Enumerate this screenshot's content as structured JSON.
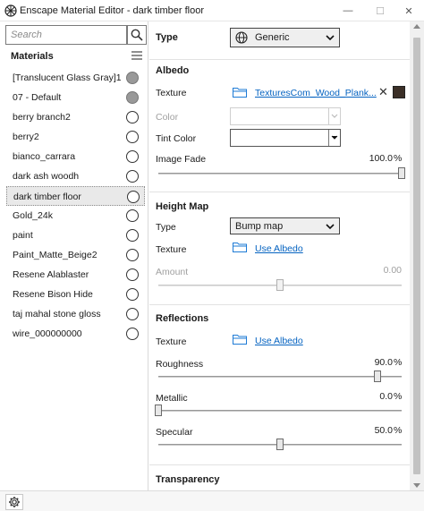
{
  "window": {
    "title": "Enscape Material Editor - dark timber floor",
    "minimize_glyph": "—",
    "maximize_glyph": "☐",
    "close_glyph": "✕"
  },
  "search": {
    "placeholder": "Search",
    "value": ""
  },
  "materials": {
    "header": "Materials",
    "selected_index": 6,
    "items": [
      {
        "name": "[Translucent Glass Gray]1",
        "radio": "filled"
      },
      {
        "name": "07 - Default",
        "radio": "filled"
      },
      {
        "name": "berry branch2",
        "radio": "empty"
      },
      {
        "name": "berry2",
        "radio": "empty"
      },
      {
        "name": "bianco_carrara",
        "radio": "empty"
      },
      {
        "name": "dark ash woodh",
        "radio": "empty"
      },
      {
        "name": "dark timber floor",
        "radio": "empty"
      },
      {
        "name": "Gold_24k",
        "radio": "empty"
      },
      {
        "name": "paint",
        "radio": "empty"
      },
      {
        "name": "Paint_Matte_Beige2",
        "radio": "empty"
      },
      {
        "name": "Resene Alablaster",
        "radio": "empty"
      },
      {
        "name": "Resene Bison Hide",
        "radio": "empty"
      },
      {
        "name": "taj mahal stone gloss",
        "radio": "empty"
      },
      {
        "name": "wire_000000000",
        "radio": "empty"
      }
    ]
  },
  "type": {
    "label": "Type",
    "value": "Generic"
  },
  "albedo": {
    "title": "Albedo",
    "texture_label": "Texture",
    "texture_file": "TexturesCom_Wood_Plank...",
    "clear_glyph": "✕",
    "swatch_color": "#3b2f27",
    "color_label": "Color",
    "tint_label": "Tint Color",
    "image_fade_label": "Image Fade",
    "image_fade_value": "100.0",
    "image_fade_unit": "%",
    "image_fade_fraction": 1.0
  },
  "height_map": {
    "title": "Height Map",
    "type_label": "Type",
    "type_value": "Bump map",
    "texture_label": "Texture",
    "texture_link": "Use Albedo",
    "amount_label": "Amount",
    "amount_value": "0.00",
    "amount_fraction": 0.5
  },
  "reflections": {
    "title": "Reflections",
    "texture_label": "Texture",
    "texture_link": "Use Albedo",
    "roughness_label": "Roughness",
    "roughness_value": "90.0",
    "roughness_unit": "%",
    "roughness_fraction": 0.9,
    "metallic_label": "Metallic",
    "metallic_value": "0.0",
    "metallic_unit": "%",
    "metallic_fraction": 0.0,
    "specular_label": "Specular",
    "specular_value": "50.0",
    "specular_unit": "%",
    "specular_fraction": 0.5
  },
  "transparency": {
    "title": "Transparency"
  },
  "icons": {
    "app": "enscape-logo-icon",
    "search": "search-icon",
    "menu": "hamburger-menu-icon",
    "type": "globe-icon",
    "folder": "folder-icon",
    "settings": "gear-icon"
  },
  "colors": {
    "link": "#0563c1",
    "folder": "#1e7bd6",
    "selection": "#e9e9e9"
  }
}
